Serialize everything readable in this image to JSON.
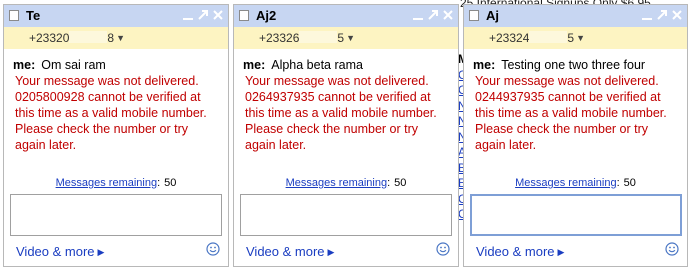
{
  "background": {
    "snippet": "25 International Signups Only $6.95",
    "link_letters": [
      "M",
      "C",
      "C",
      "N",
      "N",
      "N",
      "A",
      "B",
      "E",
      "C",
      "C"
    ]
  },
  "chats": [
    {
      "title": "Te",
      "number_prefix": "+23320",
      "number_suffix": "8",
      "me_label": "me:",
      "message": "Om sai ram",
      "error": "Your message was not delivered.\n0205800928 cannot be verified at\nthis time as a valid mobile number.\nPlease check the number or try\nagain later.",
      "remaining_label": "Messages remaining",
      "remaining_count": "50",
      "video_more": "Video & more"
    },
    {
      "title": "Aj2",
      "number_prefix": "+23326",
      "number_suffix": "5",
      "me_label": "me:",
      "message": "Alpha beta rama",
      "error": "Your message was not delivered.\n0264937935 cannot be verified at\nthis time as a valid mobile number.\nPlease check the number or try\nagain later.",
      "remaining_label": "Messages remaining",
      "remaining_count": "50",
      "video_more": "Video & more"
    },
    {
      "title": "Aj",
      "number_prefix": "+23324",
      "number_suffix": "5",
      "me_label": "me:",
      "message": "Testing one two three four",
      "error": "Your message was not delivered.\n0244937935 cannot be verified at\nthis time as a valid mobile number.\nPlease check the number or try\nagain later.",
      "remaining_label": "Messages remaining",
      "remaining_count": "50",
      "video_more": "Video & more"
    }
  ],
  "colors": {
    "titlebar": "#c7d6f2",
    "numberbar": "#fdf4c2",
    "error_text": "#c00000",
    "link": "#1a3dc1"
  },
  "icons": {
    "status": "status-square-icon",
    "minimize": "minimize-icon",
    "popout": "popout-icon",
    "close": "close-icon",
    "dropdown": "dropdown-arrow-icon",
    "emoticon": "smiley-icon"
  }
}
